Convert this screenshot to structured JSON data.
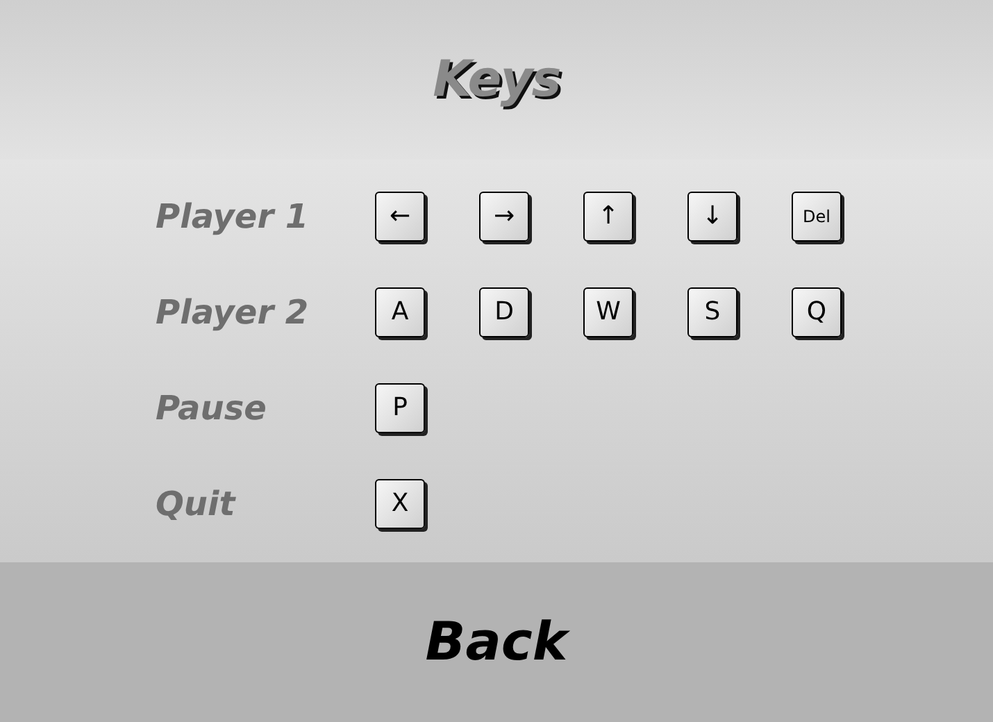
{
  "title": "Keys",
  "bindings": [
    {
      "label": "Player 1",
      "keys": [
        "←",
        "→",
        "↑",
        "↓",
        "Del"
      ]
    },
    {
      "label": "Player 2",
      "keys": [
        "A",
        "D",
        "W",
        "S",
        "Q"
      ]
    },
    {
      "label": "Pause",
      "keys": [
        "P"
      ]
    },
    {
      "label": "Quit",
      "keys": [
        "X"
      ]
    }
  ],
  "back_button": "Back"
}
